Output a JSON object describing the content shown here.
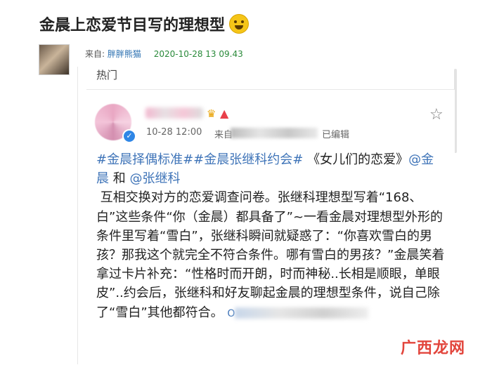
{
  "article": {
    "title": "金晨上恋爱节目写的理想型",
    "author_prefix": "来自:",
    "author": "胖胖熊猫",
    "published": "2020-10-28 13 09.43"
  },
  "section": {
    "hot_label": "热门"
  },
  "post": {
    "time": "10-28 12:00",
    "from_prefix": "来自",
    "edited_label": "已编辑",
    "tag1": "#金晨择偶标准#",
    "tag2": "#金晨张继科约会#",
    "title_text": "《女儿们的恋爱》",
    "mention1": "@金晨",
    "and_text": " 和 ",
    "mention2": "@张继科",
    "body": "互相交换对方的恋爱调查问卷。张继科理想型写着“168、白”这些条件“你（金晨）都具备了”~一看金晨对理想型外形的条件里写着“雪白”，张继科瞬间就疑惑了：“你喜欢雪白的男孩？那我这个就完全不符合条件。哪有雪白的男孩？”金晨笑着拿过卡片补充：“性格时而开朗，时而神秘..长相是顺眼，单眼皮”..约会后，张继科和好友聊起金晨的理想型条件，说自己除了“雪白”其他都符合。",
    "tail_char": "O"
  },
  "watermark": "广西龙网",
  "colors": {
    "link": "#3f74b8",
    "time_green": "#2a8a3a",
    "author_blue": "#2a6fb0",
    "watermark_red": "#e0362c"
  },
  "icons": [
    "laughing-emoji-icon",
    "verified-icon",
    "crown-icon",
    "vip-badge-icon",
    "star-icon"
  ]
}
